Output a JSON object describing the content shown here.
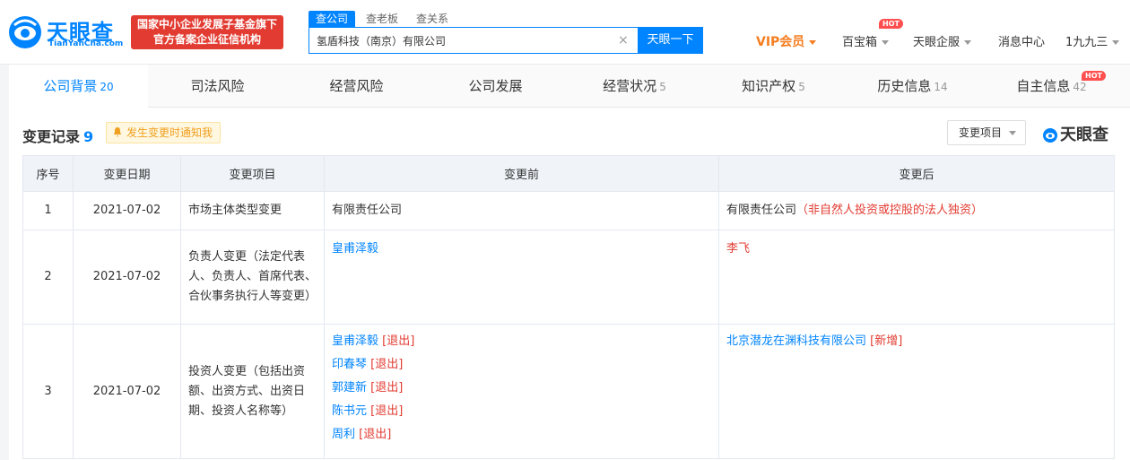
{
  "header": {
    "logo_text": "天眼查",
    "logo_sub": "TianYanCha.com",
    "gov_badge_line1": "国家中小企业发展子基金旗下",
    "gov_badge_line2": "官方备案企业征信机构",
    "search_tabs": [
      "查公司",
      "查老板",
      "查关系"
    ],
    "search_value": "氢盾科技（南京）有限公司",
    "search_clear": "×",
    "search_button": "天眼一下",
    "nav": {
      "vip": "VIP会员",
      "baibaoxiang": "百宝箱",
      "hot": "HOT",
      "qifu": "天眼企服",
      "messages": "消息中心",
      "user": "1九九三"
    }
  },
  "tabs": [
    {
      "label": "公司背景",
      "count": "20"
    },
    {
      "label": "司法风险",
      "count": ""
    },
    {
      "label": "经营风险",
      "count": ""
    },
    {
      "label": "公司发展",
      "count": ""
    },
    {
      "label": "经营状况",
      "count": "5"
    },
    {
      "label": "知识产权",
      "count": "5"
    },
    {
      "label": "历史信息",
      "count": "14"
    },
    {
      "label": "自主信息",
      "count": "42"
    }
  ],
  "tab_hot": "HOT",
  "section": {
    "title": "变更记录",
    "count": "9",
    "notify": "发生变更时通知我",
    "filter": "变更项目",
    "brand": "天眼查"
  },
  "table": {
    "headers": [
      "序号",
      "变更日期",
      "变更项目",
      "变更前",
      "变更后"
    ],
    "rows": [
      {
        "no": "1",
        "date": "2021-07-02",
        "item": "市场主体类型变更",
        "before": "有限责任公司",
        "after_main": "有限责任公司",
        "after_note": "（非自然人投资或控股的法人独资）"
      },
      {
        "no": "2",
        "date": "2021-07-02",
        "item": "负责人变更（法定代表人、负责人、首席代表、合伙事务执行人等变更）",
        "before": "皇甫泽毅",
        "after": "李飞"
      },
      {
        "no": "3",
        "date": "2021-07-02",
        "item": "投资人变更（包括出资额、出资方式、出资日期、投资人名称等）",
        "before": [
          {
            "name": "皇甫泽毅",
            "tag": "[退出]"
          },
          {
            "name": "印春琴",
            "tag": "[退出]"
          },
          {
            "name": "郭建新",
            "tag": "[退出]"
          },
          {
            "name": "陈书元",
            "tag": "[退出]"
          },
          {
            "name": "周利",
            "tag": "[退出]"
          }
        ],
        "after": [
          {
            "name": "北京潜龙在渊科技有限公司",
            "tag": "[新增]"
          }
        ]
      }
    ]
  }
}
